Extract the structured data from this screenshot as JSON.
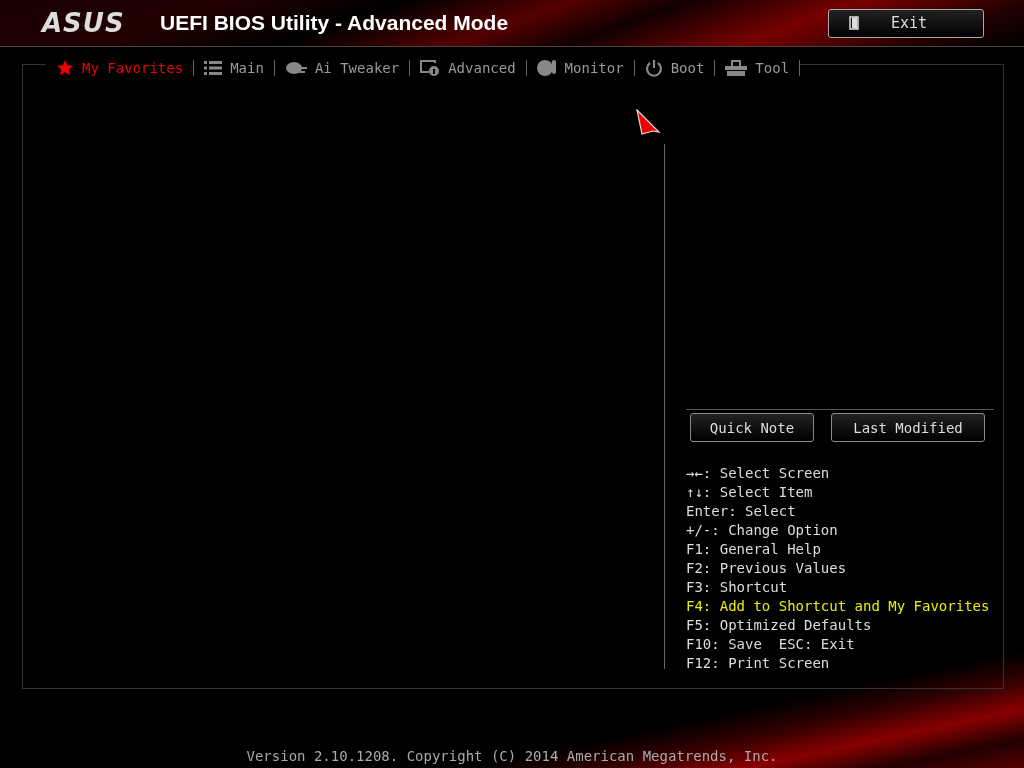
{
  "header": {
    "logo": "ASUS",
    "title": "UEFI BIOS Utility - Advanced Mode",
    "exit_button": "Exit"
  },
  "tabs": [
    {
      "label": "My Favorites",
      "selected": true
    },
    {
      "label": "Main",
      "selected": false
    },
    {
      "label": "Ai Tweaker",
      "selected": false
    },
    {
      "label": "Advanced",
      "selected": false
    },
    {
      "label": "Monitor",
      "selected": false
    },
    {
      "label": "Boot",
      "selected": false
    },
    {
      "label": "Tool",
      "selected": false
    }
  ],
  "side_buttons": [
    "Quick Note",
    "Last Modified"
  ],
  "help_lines": [
    {
      "text": "→←: Select Screen",
      "highlighted": false
    },
    {
      "text": "↑↓: Select Item",
      "highlighted": false
    },
    {
      "text": "Enter: Select",
      "highlighted": false
    },
    {
      "text": "+/-: Change Option",
      "highlighted": false
    },
    {
      "text": "F1: General Help",
      "highlighted": false
    },
    {
      "text": "F2: Previous Values",
      "highlighted": false
    },
    {
      "text": "F3: Shortcut",
      "highlighted": false
    },
    {
      "text": "F4: Add to Shortcut and My Favorites",
      "highlighted": true
    },
    {
      "text": "F5: Optimized Defaults",
      "highlighted": false
    },
    {
      "text": "F10: Save  ESC: Exit",
      "highlighted": false
    },
    {
      "text": "F12: Print Screen",
      "highlighted": false
    }
  ],
  "footer": "Version 2.10.1208. Copyright (C) 2014 American Megatrends, Inc."
}
